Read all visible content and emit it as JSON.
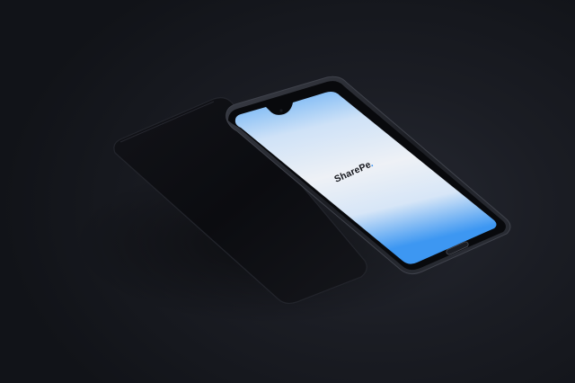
{
  "scene": {
    "description_free": true
  },
  "app_screen": {
    "brand_name": "SharePe",
    "brand_mark": ".",
    "gradient_top": "#5aa8f5",
    "gradient_mid": "#e9eef6",
    "gradient_bottom": "#3d97f2"
  },
  "colors": {
    "background": "#16181e",
    "phone_body": "#0c0d11",
    "phone_frame": "#2a2c33"
  }
}
